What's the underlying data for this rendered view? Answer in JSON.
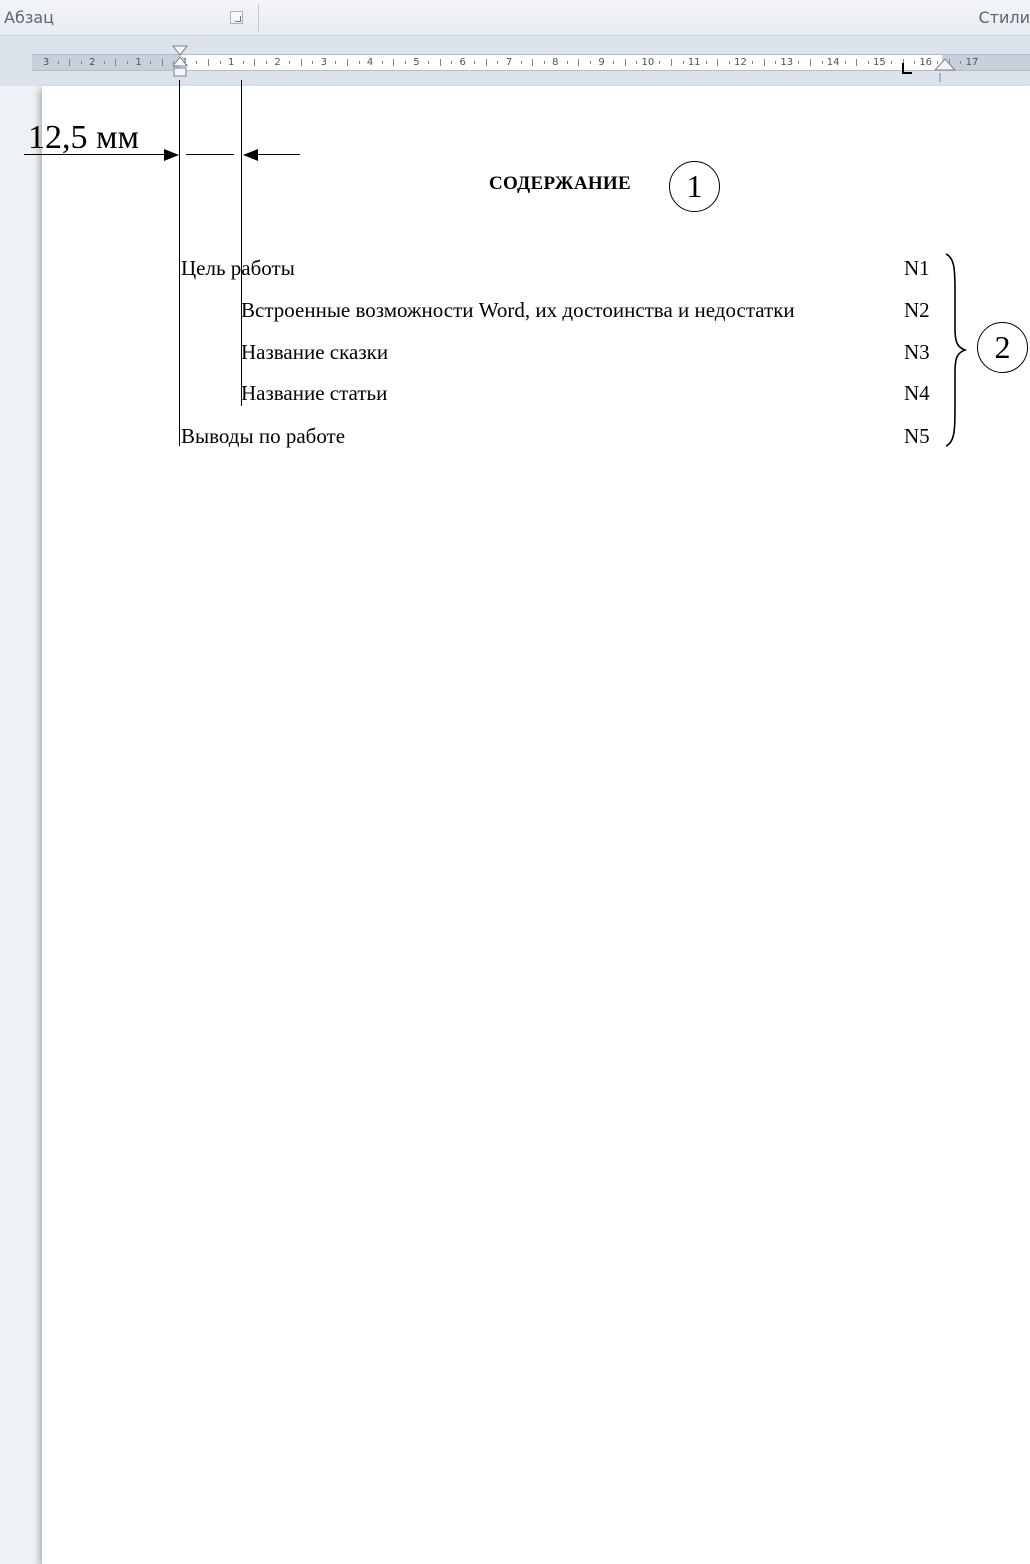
{
  "ribbon": {
    "left_group": "Абзац",
    "right_group": "Стили"
  },
  "ruler": {
    "labels": [
      "3",
      "2",
      "1",
      "1",
      "1",
      "2",
      "3",
      "4",
      "5",
      "6",
      "7",
      "8",
      "9",
      "10",
      "11",
      "12",
      "13",
      "14",
      "15",
      "16",
      "17"
    ]
  },
  "annotation": {
    "indent_text": "12,5 мм",
    "callout_1": "1",
    "callout_2": "2"
  },
  "toc": {
    "title": "СОДЕРЖАНИЕ",
    "entries": [
      {
        "text": "Цель работы",
        "page": "N1"
      },
      {
        "text": "Встроенные возможности Word, их достоинства и недостатки",
        "page": "N2"
      },
      {
        "text": "Название сказки",
        "page": "N3"
      },
      {
        "text": "Название статьи",
        "page": "N4"
      },
      {
        "text": "Выводы по работе",
        "page": "N5"
      }
    ]
  }
}
